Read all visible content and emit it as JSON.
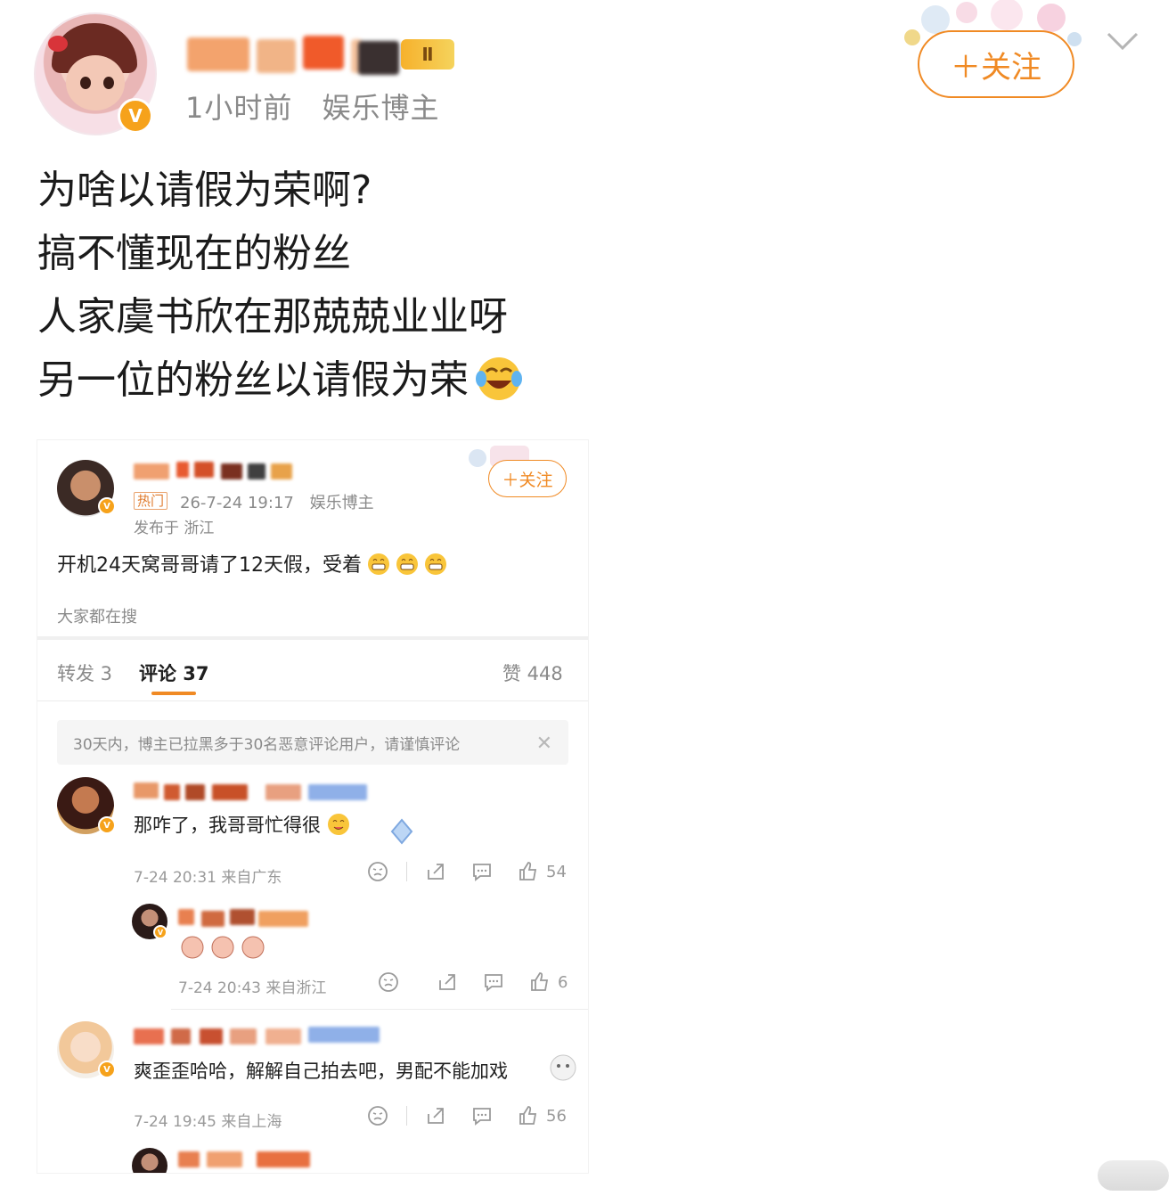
{
  "post": {
    "meta_time": "1小时前",
    "meta_role": "娱乐博主",
    "follow_label": "＋关注",
    "lines": [
      "为啥以请假为荣啊?",
      "搞不懂现在的粉丝",
      "人家虞书欣在那兢兢业业呀",
      "另一位的粉丝以请假为荣"
    ]
  },
  "embedded": {
    "hot_tag": "热门",
    "date": "26-7-24 19:17",
    "role": "娱乐博主",
    "location": "发布于 浙江",
    "follow_label": "＋关注",
    "text": "开机24天窝哥哥请了12天假，受着",
    "everyone_searching": "大家都在搜",
    "tabs": {
      "repost": "转发 3",
      "comments": "评论 37",
      "likes": "赞 448"
    },
    "notice": "30天内，博主已拉黑多于30名恶意评论用户，请谨慎评论",
    "comments": [
      {
        "text": "那咋了，我哥哥忙得很",
        "time": "7-24 20:31 来自广东",
        "likes": "54"
      },
      {
        "text": "",
        "time": "7-24 20:43 来自浙江",
        "likes": "6"
      },
      {
        "text": "爽歪歪哈哈，解解自己拍去吧，男配不能加戏",
        "time": "7-24 19:45 来自上海",
        "likes": "56"
      }
    ]
  },
  "colors": {
    "accent": "#f08a24",
    "verified": "#f6a21b",
    "muted": "#8a8a8a"
  }
}
